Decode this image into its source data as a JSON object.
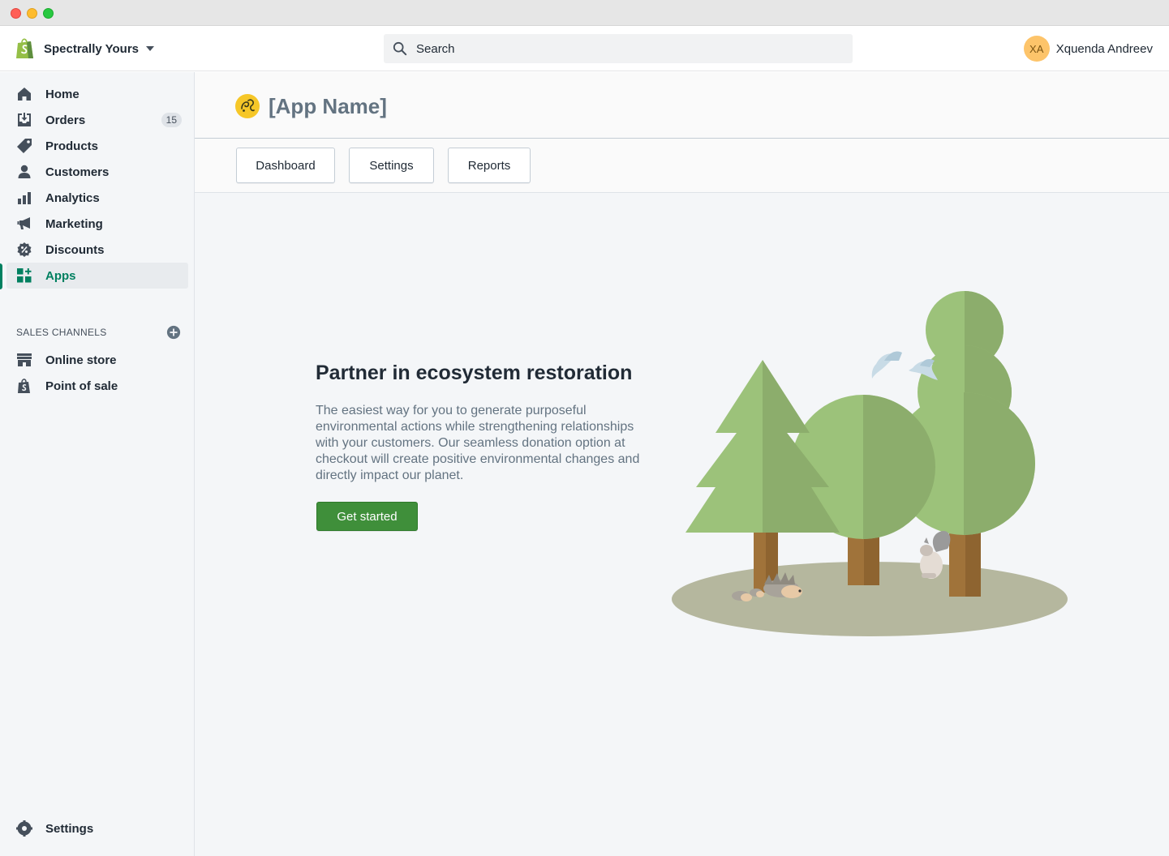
{
  "window": {
    "controls": [
      "close",
      "minimize",
      "maximize"
    ]
  },
  "topbar": {
    "store_name": "Spectrally Yours",
    "search": {
      "placeholder": "Search"
    },
    "user": {
      "initials": "XA",
      "name": "Xquenda Andreev",
      "avatar_color": "#fdc46a"
    }
  },
  "sidebar": {
    "items": [
      {
        "label": "Home",
        "icon": "home-icon"
      },
      {
        "label": "Orders",
        "icon": "orders-icon",
        "badge": "15"
      },
      {
        "label": "Products",
        "icon": "tag-icon"
      },
      {
        "label": "Customers",
        "icon": "person-icon"
      },
      {
        "label": "Analytics",
        "icon": "bar-chart-icon"
      },
      {
        "label": "Marketing",
        "icon": "megaphone-icon"
      },
      {
        "label": "Discounts",
        "icon": "discount-icon"
      },
      {
        "label": "Apps",
        "icon": "apps-icon",
        "active": true
      }
    ],
    "sales_channels": {
      "title": "SALES CHANNELS",
      "items": [
        {
          "label": "Online store",
          "icon": "store-icon"
        },
        {
          "label": "Point of sale",
          "icon": "pos-bag-icon"
        }
      ]
    },
    "settings_label": "Settings",
    "accent_color": "#008060"
  },
  "app": {
    "name": "[App Name]",
    "tabs": [
      "Dashboard",
      "Settings",
      "Reports"
    ],
    "hero": {
      "title": "Partner in ecosystem restoration",
      "text": "The easiest way for you to generate purposeful environmental actions while strengthening relationships with your customers. Our seamless donation option at checkout will create positive environmental changes and directly impact our planet.",
      "cta": "Get started",
      "cta_color": "#3f8f3a"
    }
  }
}
